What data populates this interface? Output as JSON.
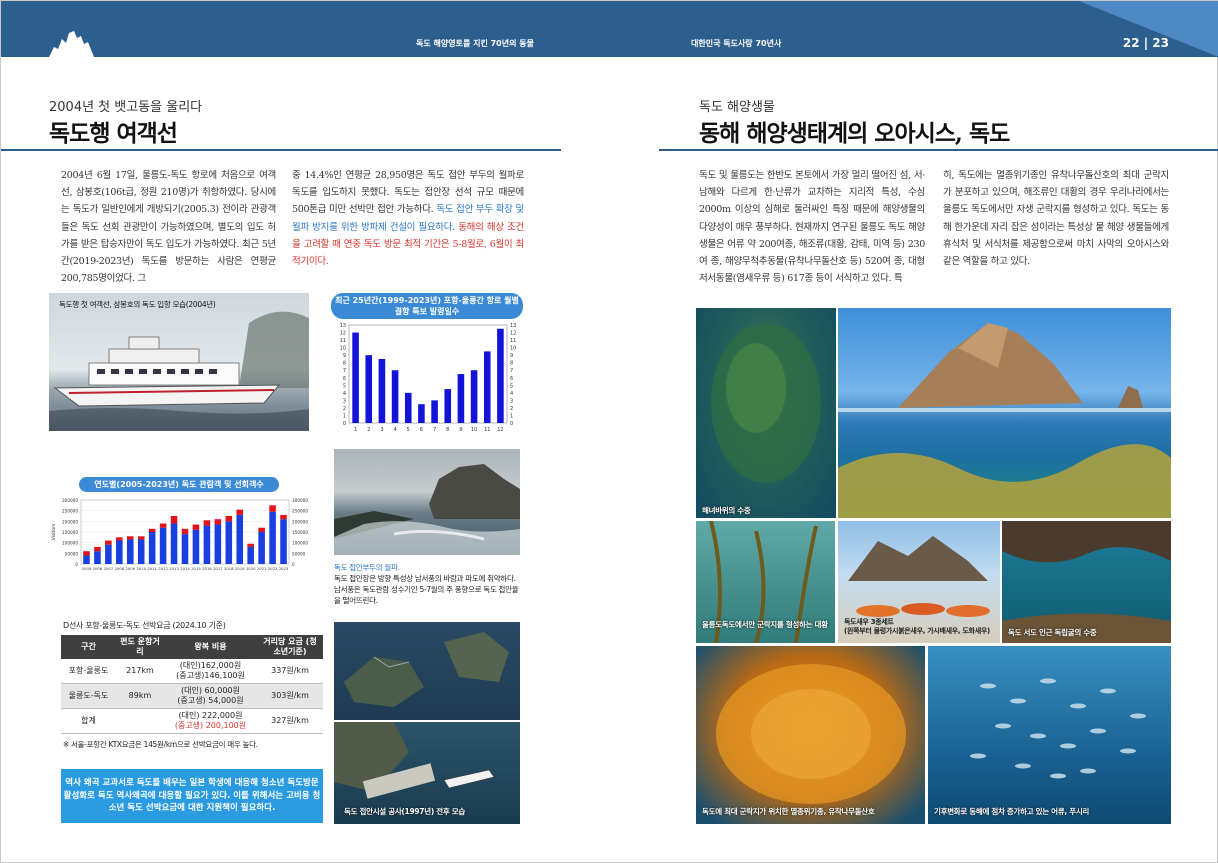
{
  "header": {
    "running_left": "독도 해양영토를 지킨 70년의 동물",
    "running_right": "대한민국 독도사랑 70년사",
    "page_numbers": "22 | 23"
  },
  "left": {
    "subtitle": "2004년 첫 뱃고동을 울리다",
    "title": "독도행 여객선",
    "col1": "2004년 6월 17일, 울릉도-독도 항로에 처음으로 여객선, 삼봉호(106t급, 정원 210명)가 취항하였다. 당시에는 독도가 일반인에게 개방되기(2005.3) 전이라 관광객들은 독도 선회 관광만이 가능하였으며, 별도의 입도 허가를 받은 탑승자만이 독도 입도가 가능하였다. 최근 5년간(2019-2023년) 독도를 방문하는 사람은 연평균 200,785명이었다. 그",
    "col2_plain": "중 14.4%인 연평균 28,950명은 독도 접안 부두의 월파로 독도를 입도하지 못했다. 독도는 접안장 선석 규모 때문에 500톤급 미만 선박만 접안 가능하다.",
    "col2_blue": " 독도 접안 부두 확장 및 월파 방지를 위한 방파제 건설이 필요하다.",
    "col2_red": " 동해의 해상 조건을 고려할 때 연중 독도 방문 최적 기간은 5-8월로, 6월이 최적기이다.",
    "photo1_caption": "독도행 첫 여객선, 삼봉호의 독도 입항 모습(2004년)",
    "photo2_caption_title": "독도 접안부두의 월파.",
    "photo2_caption_body": "독도 접안장은 방향 특성상 남서풍의 바람과 파도에 취약하다. 남서풍은 독도관람 성수기인 5-7월의 주 풍향으로 독도 접안율을 떨어뜨린다.",
    "photo3_caption": "독도 접안시설 공사(1997년) 전후 모습",
    "fare_title": "D선사 포항-울릉도-독도 선박요금 (2024.10 기준)",
    "fare_headers": [
      "구간",
      "편도 운항거리",
      "왕복 비용",
      "거리당 요금 (청소년기준)"
    ],
    "fare_rows": [
      {
        "route": "포항-울릉도",
        "dist": "217km",
        "cost1": "(대인)162,000원",
        "cost2": "(중고생)146,100원",
        "per": "337원/km"
      },
      {
        "route": "울릉도-독도",
        "dist": "89km",
        "cost1": "(대인) 60,000원",
        "cost2": "(중고생) 54,000원",
        "per": "303원/km"
      },
      {
        "route": "합계",
        "dist": "",
        "cost1": "(대인) 222,000원",
        "cost2": "(중고생) 200,100원",
        "per": "327원/km"
      }
    ],
    "fare_note": "※ 서울-포항간 KTX요금은 145원/km으로 선박요금이 매우 높다.",
    "banner": "역사 왜곡 교과서로 독도를 배우는 일본 학생에 대응해 청소년 독도방문 활성화로 독도 역사왜곡에 대응할 필요가 있다. 이를 위해서는 고비용 청소년 독도 선박요금에 대한 지원책이 필요하다."
  },
  "right": {
    "subtitle": "독도 해양생물",
    "title": "동해 해양생태계의 오아시스, 독도",
    "col1": "독도 및 울릉도는 한반도 본토에서 가장 멀리 떨어진 섬, 서·남해와 다르게 한·난류가 교차하는 지리적 특성, 수심 2000m 이상의 심해로 둘러싸인 특징 때문에 해양생물의 다양성이 매우 풍부하다. 현재까지 연구된 울릉도 독도 해양생물은 어류 약 200여종, 해조류(대황, 감태, 미역 등) 230여 종, 해양무척추동물(유착나무돌산호 등) 520여 종, 대형저서동물(염새우류 등) 617종 등이 서식하고 있다. 특",
    "col2": "히, 독도에는 멸종위기종인 유착나무돌산호의 최대 군락지가 분포하고 있으며, 해조류인 대황의 경우 우리나라에서는 울릉도 독도에서만 자생 군락지를 형성하고 있다. 독도는 동해 한가운데 자리 잡은 섬이라는 특성상 뭍 해양 생물들에게 휴식처 및 서식처를 제공함으로써 마치 사막의 오아시스와 같은 역할을 하고 있다.",
    "cap_rock": "해녀바위의 수중",
    "cap_kelp": "울릉도독도에서만 군락지를 형성하는 대황",
    "cap_shrimp": "독도새우 3종세트",
    "cap_shrimp_sub": "(왼쪽부터 물렁가시붉은새우, 가시배새우, 도화새우)",
    "cap_cave": "독도 서도 인근 독립굴의 수중",
    "cap_coral": "독도에 최대 군락지가 위치한 멸종위기종, 유착나무돌산호",
    "cap_fish": "기후변화로 동해에 점차 증가하고 있는 어류, 푸시리"
  },
  "chart_data": [
    {
      "type": "bar",
      "title": "최근 25년간(1999-2023년) 포항-울릉간 항로 월별 결항 특보 발령일수",
      "categories": [
        "1",
        "2",
        "3",
        "4",
        "5",
        "6",
        "7",
        "8",
        "9",
        "10",
        "11",
        "12"
      ],
      "values": [
        12,
        9,
        8.5,
        7,
        4,
        2.5,
        3,
        4.5,
        6.5,
        7,
        9.5,
        12.5
      ],
      "ylim": [
        0,
        13
      ],
      "yticks": [
        "0",
        "1",
        "2",
        "3",
        "4",
        "5",
        "6",
        "7",
        "8",
        "9",
        "10",
        "11",
        "12",
        "13"
      ],
      "color": "#1414d8"
    },
    {
      "type": "bar",
      "title": "연도별(2005-2023년) 독도 관람객 및 선회객수",
      "categories": [
        "2005",
        "2006",
        "2007",
        "2008",
        "2009",
        "2010",
        "2011",
        "2012",
        "2013",
        "2014",
        "2015",
        "2016",
        "2017",
        "2018",
        "2019",
        "2020",
        "2021",
        "2022",
        "2023"
      ],
      "series": [
        {
          "values": [
            40000,
            60000,
            90000,
            110000,
            115000,
            115000,
            150000,
            170000,
            190000,
            140000,
            160000,
            180000,
            185000,
            200000,
            230000,
            80000,
            150000,
            245000,
            210000
          ],
          "color": "#1a3fe0"
        },
        {
          "values": [
            20000,
            20000,
            20000,
            15000,
            15000,
            15000,
            15000,
            20000,
            35000,
            25000,
            25000,
            25000,
            25000,
            25000,
            25000,
            15000,
            20000,
            30000,
            20000
          ],
          "color": "#e0141c"
        }
      ],
      "ylim": [
        0,
        300000
      ],
      "yticks": [
        "0",
        "50000",
        "100000",
        "150000",
        "200000",
        "250000",
        "300000"
      ],
      "ylabel": "Visitors"
    }
  ]
}
